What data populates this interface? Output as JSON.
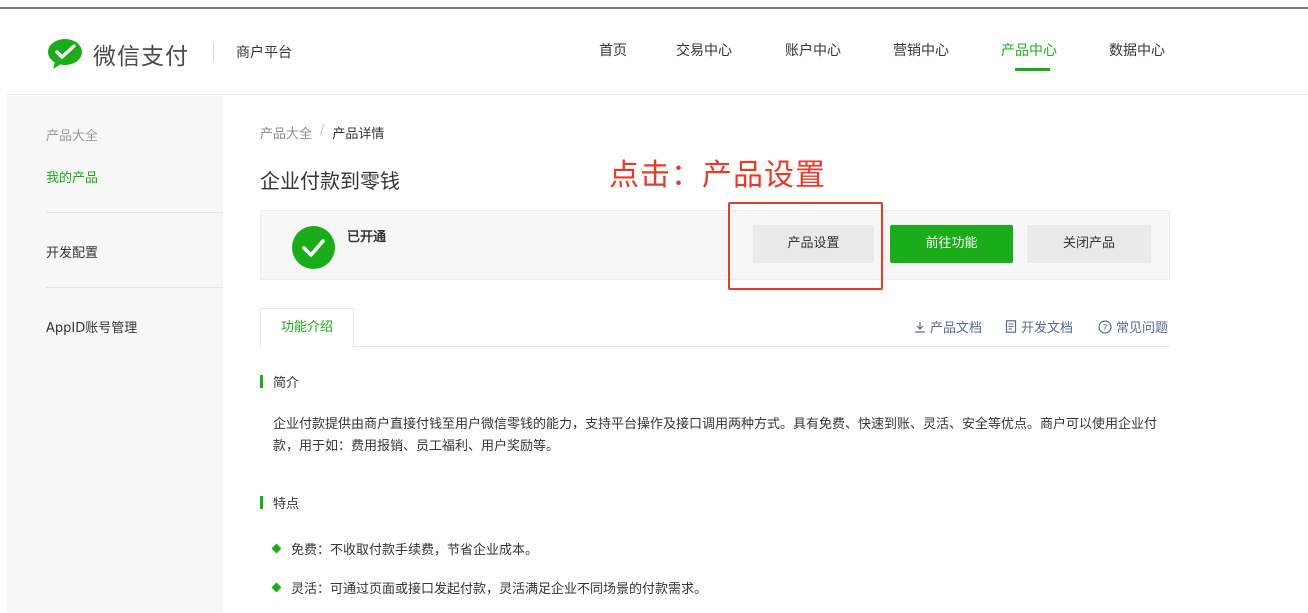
{
  "header": {
    "logo_text": "微信支付",
    "merchant_platform": "商户平台",
    "nav": [
      {
        "label": "首页",
        "active": false
      },
      {
        "label": "交易中心",
        "active": false
      },
      {
        "label": "账户中心",
        "active": false
      },
      {
        "label": "营销中心",
        "active": false
      },
      {
        "label": "产品中心",
        "active": true
      },
      {
        "label": "数据中心",
        "active": false
      }
    ]
  },
  "sidebar": {
    "title": "产品大全",
    "my_products": "我的产品",
    "dev_config": "开发配置",
    "appid_mgmt": "AppID账号管理"
  },
  "breadcrumb": {
    "root": "产品大全",
    "separator": "/",
    "current": "产品详情"
  },
  "page": {
    "title": "企业付款到零钱",
    "annotation": "点击：产品设置"
  },
  "status": {
    "label": "已开通",
    "settings_button": "产品设置",
    "goto_button": "前往功能",
    "close_button": "关闭产品"
  },
  "tabs": {
    "intro": "功能介绍",
    "product_docs": "产品文档",
    "dev_docs": "开发文档",
    "faq": "常见问题"
  },
  "content": {
    "intro_heading": "简介",
    "intro_text": "企业付款提供由商户直接付钱至用户微信零钱的能力，支持平台操作及接口调用两种方式。具有免费、快速到账、灵活、安全等优点。商户可以使用企业付款，用于如：费用报销、员工福利、用户奖励等。",
    "features_heading": "特点",
    "features": [
      "免费：不收取付款手续费，节省企业成本。",
      "灵活：可通过页面或接口发起付款，灵活满足企业不同场景的付款需求。"
    ]
  },
  "colors": {
    "brand_green": "#1aad19",
    "annotation_red": "#e63a2b",
    "link_blue": "#576b95"
  }
}
